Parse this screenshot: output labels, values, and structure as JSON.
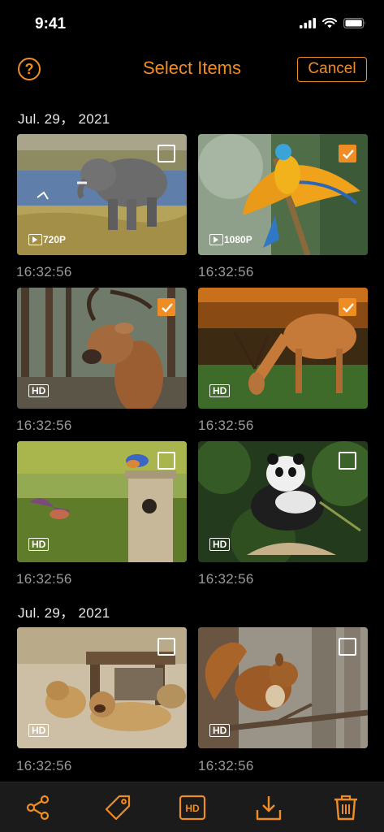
{
  "status": {
    "time": "9:41"
  },
  "nav": {
    "title": "Select Items",
    "help_label": "?",
    "cancel_label": "Cancel"
  },
  "sections": [
    {
      "date": "Jul. 29， 2021"
    },
    {
      "date": "Jul. 29， 2021"
    }
  ],
  "items": [
    {
      "subject": "elephant",
      "selected": false,
      "type": "video",
      "resolution": "720P",
      "time": "16:32:56"
    },
    {
      "subject": "macaw",
      "selected": true,
      "type": "video",
      "resolution": "1080P",
      "time": "16:32:56"
    },
    {
      "subject": "deer-portrait",
      "selected": true,
      "type": "photo",
      "quality": "HD",
      "time": "16:32:56"
    },
    {
      "subject": "deer-grazing",
      "selected": true,
      "type": "photo",
      "quality": "HD",
      "time": "16:32:56"
    },
    {
      "subject": "bluebirds",
      "selected": false,
      "type": "photo",
      "quality": "HD",
      "time": "16:32:56"
    },
    {
      "subject": "panda",
      "selected": false,
      "type": "photo",
      "quality": "HD",
      "time": "16:32:56"
    },
    {
      "subject": "lions",
      "selected": false,
      "type": "photo",
      "quality": "HD",
      "time": "16:32:56"
    },
    {
      "subject": "squirrel",
      "selected": false,
      "type": "photo",
      "quality": "HD",
      "time": "16:32:56"
    }
  ],
  "toolbar": {
    "items": [
      {
        "icon": "share-icon"
      },
      {
        "icon": "tag-icon"
      },
      {
        "icon": "hd-icon",
        "label": "HD"
      },
      {
        "icon": "download-icon"
      },
      {
        "icon": "trash-icon"
      }
    ]
  },
  "colors": {
    "accent": "#ef8d25",
    "background": "#000000",
    "toolbar": "#1b1b1b",
    "timestamp": "#9a9a9a"
  }
}
